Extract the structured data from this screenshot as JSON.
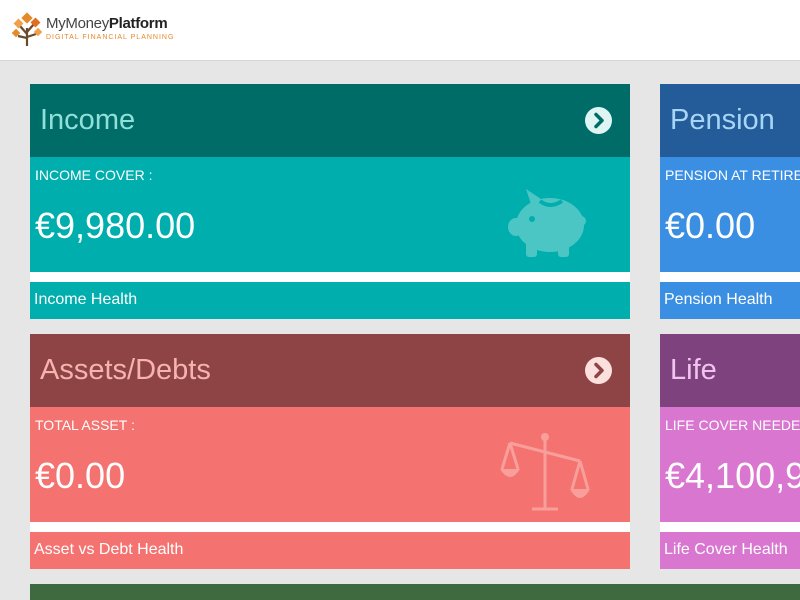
{
  "header": {
    "logo_title_light": "MyMoney",
    "logo_title_bold": "Platform",
    "logo_subtitle": "DIGITAL FINANCIAL PLANNING",
    "logo_icon": "tree-icon"
  },
  "cards": {
    "income": {
      "title": "Income",
      "label": "INCOME COVER :",
      "value": "€9,980.00",
      "footer": "Income Health",
      "icon": "piggy-bank-icon"
    },
    "pension": {
      "title": "Pension",
      "label": "PENSION AT RETIRE",
      "value": "€0.00",
      "footer": "Pension Health"
    },
    "assets": {
      "title": "Assets/Debts",
      "label": "TOTAL ASSET :",
      "value": "€0.00",
      "footer": "Asset vs Debt Health",
      "icon": "scales-icon"
    },
    "life": {
      "title": "Life",
      "label": "LIFE COVER NEEDED",
      "value": "€4,100,9",
      "footer": "Life Cover Health"
    }
  },
  "colors": {
    "income_header": "#006c67",
    "income_body": "#00aeae",
    "pension_header": "#235c99",
    "pension_body": "#3b8fe3",
    "assets_header": "#8e4444",
    "assets_body": "#f4726f",
    "life_header": "#7e437e",
    "life_body": "#d976cf",
    "bottom_card": "#3f6a3f"
  }
}
